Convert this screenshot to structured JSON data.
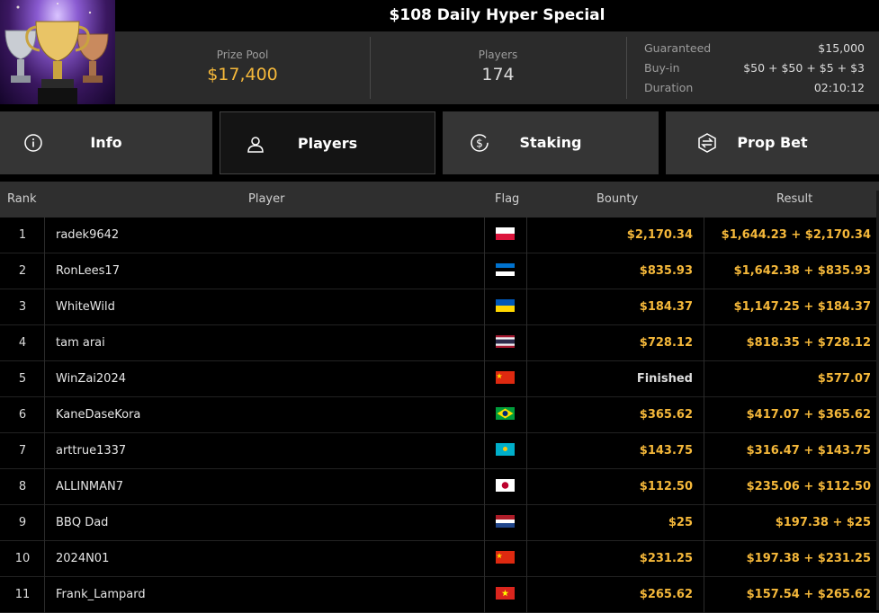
{
  "tournament": {
    "title": "$108 Daily Hyper Special",
    "prize_pool_label": "Prize Pool",
    "prize_pool_value": "$17,400",
    "players_label": "Players",
    "players_value": "174",
    "details": [
      {
        "label": "Guaranteed",
        "value": "$15,000"
      },
      {
        "label": "Buy-in",
        "value": "$50 + $50 + $5 + $3"
      },
      {
        "label": "Duration",
        "value": "02:10:12"
      }
    ]
  },
  "tabs": [
    {
      "label": "Info",
      "icon": "info-icon",
      "active": false
    },
    {
      "label": "Players",
      "icon": "user-icon",
      "active": true
    },
    {
      "label": "Staking",
      "icon": "dollar-coin-icon",
      "active": false
    },
    {
      "label": "Prop Bet",
      "icon": "prop-bet-icon",
      "active": false
    }
  ],
  "table": {
    "headers": {
      "rank": "Rank",
      "player": "Player",
      "flag": "Flag",
      "bounty": "Bounty",
      "result": "Result"
    },
    "rows": [
      {
        "rank": "1",
        "player": "radek9642",
        "flag": "poland",
        "bounty": "$2,170.34",
        "result": "$1,644.23 + $2,170.34"
      },
      {
        "rank": "2",
        "player": "RonLees17",
        "flag": "estonia",
        "bounty": "$835.93",
        "result": "$1,642.38 + $835.93"
      },
      {
        "rank": "3",
        "player": "WhiteWild",
        "flag": "ukraine",
        "bounty": "$184.37",
        "result": "$1,147.25 + $184.37"
      },
      {
        "rank": "4",
        "player": "tam arai",
        "flag": "thailand",
        "bounty": "$728.12",
        "result": "$818.35 + $728.12"
      },
      {
        "rank": "5",
        "player": "WinZai2024",
        "flag": "china",
        "bounty": "Finished",
        "result": "$577.07"
      },
      {
        "rank": "6",
        "player": "KaneDaseKora",
        "flag": "brazil",
        "bounty": "$365.62",
        "result": "$417.07 + $365.62"
      },
      {
        "rank": "7",
        "player": "arttrue1337",
        "flag": "kazakhstan",
        "bounty": "$143.75",
        "result": "$316.47 + $143.75"
      },
      {
        "rank": "8",
        "player": "ALLINMAN7",
        "flag": "japan",
        "bounty": "$112.50",
        "result": "$235.06 + $112.50"
      },
      {
        "rank": "9",
        "player": "BBQ Dad",
        "flag": "netherlands",
        "bounty": "$25",
        "result": "$197.38 + $25"
      },
      {
        "rank": "10",
        "player": "2024N01",
        "flag": "china",
        "bounty": "$231.25",
        "result": "$197.38 + $231.25"
      },
      {
        "rank": "11",
        "player": "Frank_Lampard",
        "flag": "vietnam",
        "bounty": "$265.62",
        "result": "$157.54 + $265.62"
      }
    ]
  },
  "colors": {
    "accent_gold": "#f5b83a",
    "panel": "#2b2b2b",
    "tab": "#353535"
  }
}
